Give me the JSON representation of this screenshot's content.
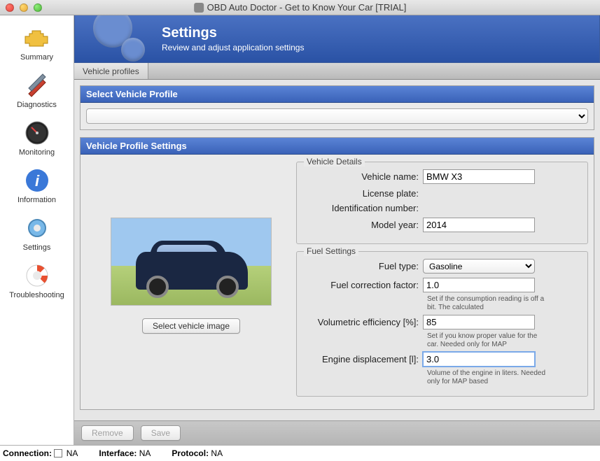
{
  "window": {
    "title": "OBD Auto Doctor - Get to Know Your Car [TRIAL]"
  },
  "sidebar": {
    "items": [
      {
        "label": "Summary",
        "icon": "engine-icon"
      },
      {
        "label": "Diagnostics",
        "icon": "tools-icon"
      },
      {
        "label": "Monitoring",
        "icon": "gauge-icon"
      },
      {
        "label": "Information",
        "icon": "info-icon"
      },
      {
        "label": "Settings",
        "icon": "gear-icon"
      },
      {
        "label": "Troubleshooting",
        "icon": "lifebuoy-icon"
      }
    ]
  },
  "banner": {
    "title": "Settings",
    "subtitle": "Review and adjust application settings"
  },
  "tabs": [
    {
      "label": "Vehicle profiles"
    }
  ],
  "groups": {
    "select_profile": {
      "title": "Select Vehicle Profile",
      "value": ""
    },
    "profile_settings": {
      "title": "Vehicle Profile Settings"
    }
  },
  "image_panel": {
    "select_button": "Select vehicle image"
  },
  "vehicle_details": {
    "legend": "Vehicle Details",
    "name_label": "Vehicle name:",
    "name_value": "BMW X3",
    "plate_label": "License plate:",
    "plate_value": "",
    "vin_label": "Identification number:",
    "vin_value": "",
    "year_label": "Model year:",
    "year_value": "2014"
  },
  "fuel_settings": {
    "legend": "Fuel Settings",
    "type_label": "Fuel type:",
    "type_value": "Gasoline",
    "correction_label": "Fuel correction factor:",
    "correction_value": "1.0",
    "correction_hint": "Set if the consumption reading is off a bit. The calculated",
    "ve_label": "Volumetric efficiency [%]:",
    "ve_value": "85",
    "ve_hint": "Set if you know proper value for the car. Needed only for MAP",
    "disp_label": "Engine displacement [l]:",
    "disp_value": "3.0",
    "disp_hint": "Volume of the engine in liters. Needed only for MAP based"
  },
  "buttons": {
    "remove": "Remove",
    "save": "Save"
  },
  "status": {
    "connection_label": "Connection:",
    "connection_value": "NA",
    "interface_label": "Interface:",
    "interface_value": "NA",
    "protocol_label": "Protocol:",
    "protocol_value": "NA"
  }
}
